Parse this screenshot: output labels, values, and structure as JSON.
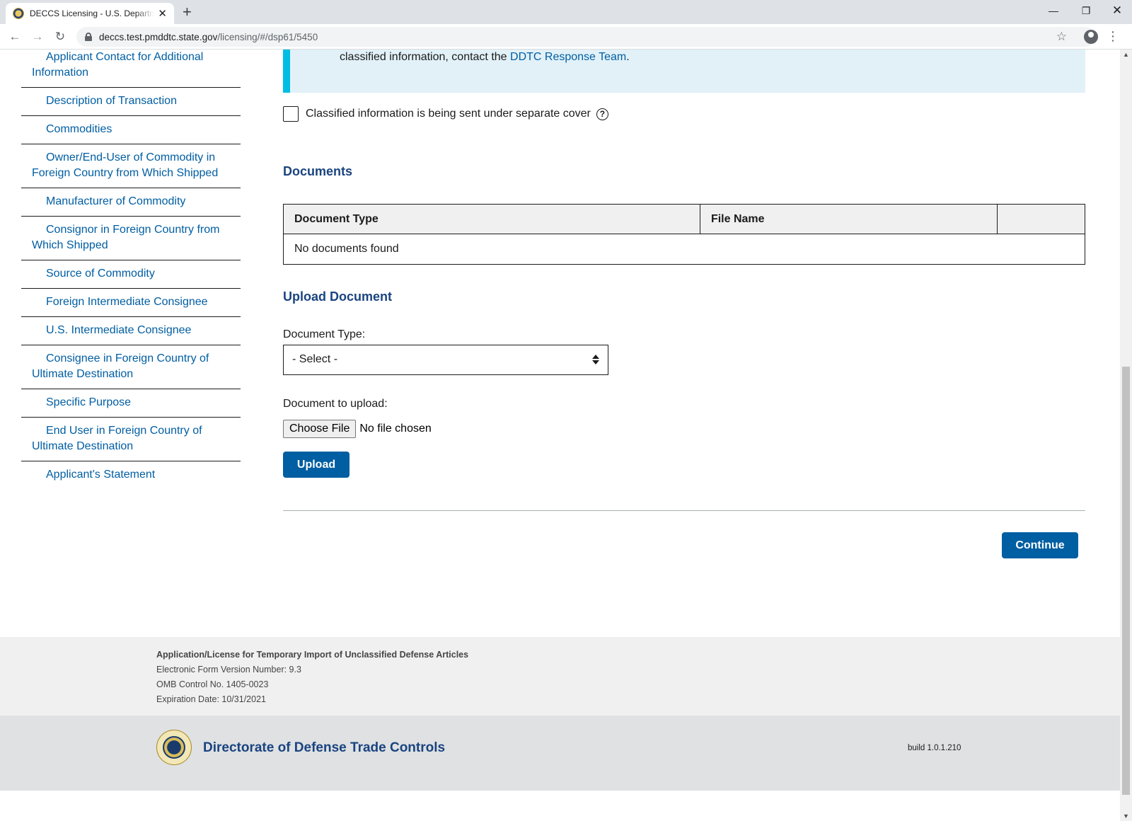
{
  "browser": {
    "tab_title": "DECCS Licensing - U.S. Department of State",
    "new_tab": "+",
    "url_host": "deccs.test.pmddtc.state.gov",
    "url_path": "/licensing/#/dsp61/5450",
    "icons": [
      "back-icon",
      "forward-icon",
      "reload-icon",
      "lock-icon",
      "star-icon",
      "profile-icon",
      "kebab-menu-icon",
      "minimize-icon",
      "restore-icon",
      "close-icon"
    ]
  },
  "sidenav": {
    "items": [
      {
        "label": "Applicant Contact for Additional Information"
      },
      {
        "label": "Description of Transaction"
      },
      {
        "label": "Commodities"
      },
      {
        "label": "Owner/End-User of Commodity in Foreign Country from Which Shipped"
      },
      {
        "label": "Manufacturer of Commodity"
      },
      {
        "label": "Consignor in Foreign Country from Which Shipped"
      },
      {
        "label": "Source of Commodity"
      },
      {
        "label": "Foreign Intermediate Consignee"
      },
      {
        "label": "U.S. Intermediate Consignee"
      },
      {
        "label": "Consignee in Foreign Country of Ultimate Destination"
      },
      {
        "label": "Specific Purpose"
      },
      {
        "label": "End User in Foreign Country of Ultimate Destination"
      },
      {
        "label": "Applicant's Statement"
      }
    ]
  },
  "alert": {
    "text_prefix": "classified information, contact the ",
    "link": "DDTC Response Team",
    "text_suffix": "."
  },
  "classified_checkbox": {
    "label": "Classified information is being sent under separate cover",
    "checked": false,
    "help": "?"
  },
  "documents": {
    "heading": "Documents",
    "columns": [
      "Document Type",
      "File Name",
      ""
    ],
    "empty_message": "No documents found"
  },
  "upload": {
    "heading": "Upload Document",
    "doc_type_label": "Document Type:",
    "doc_type_selected": "- Select -",
    "file_label": "Document to upload:",
    "choose_file": "Choose File",
    "file_status": "No file chosen",
    "upload_button": "Upload"
  },
  "actions": {
    "continue": "Continue"
  },
  "footer": {
    "form_title": "Application/License for Temporary Import of Unclassified Defense Articles",
    "version": "Electronic Form Version Number: 9.3",
    "omb": "OMB Control No. 1405-0023",
    "expiration": "Expiration Date: 10/31/2021",
    "brand": "Directorate of Defense Trade Controls",
    "build": "build 1.0.1.210"
  },
  "colors": {
    "link": "#005ea2",
    "heading": "#1a4480",
    "primary_button": "#005ea2",
    "alert_bg": "#e2f1f8",
    "alert_border": "#00bde3"
  }
}
